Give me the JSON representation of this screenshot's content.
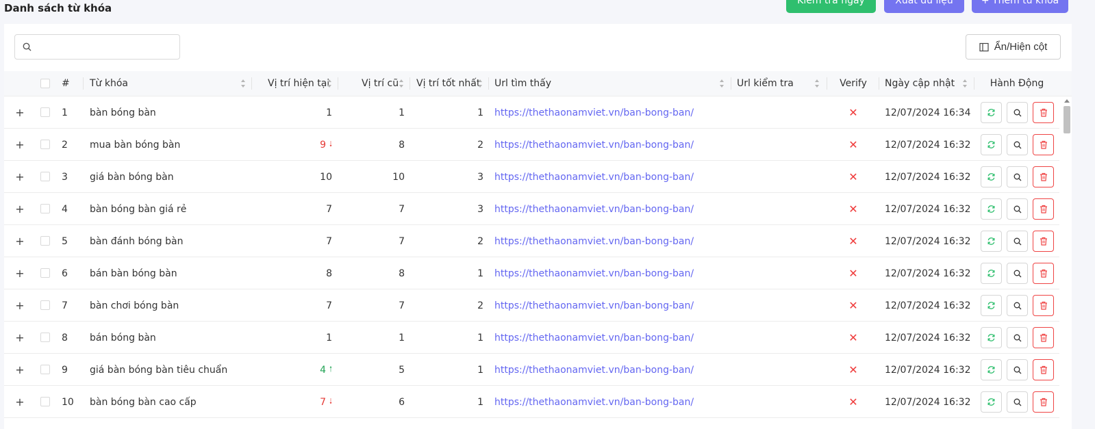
{
  "page": {
    "title": "Danh sách từ khóa",
    "buttons": {
      "check_now": "Kiểm tra ngay",
      "export": "Xuất dữ liệu",
      "add_keyword": "+ Thêm từ khóa"
    }
  },
  "toolbar": {
    "search_placeholder": "",
    "column_toggle": "Ẩn/Hiện cột"
  },
  "table": {
    "headers": {
      "index": "#",
      "keyword": "Từ khóa",
      "current_pos": "Vị trí hiện tại",
      "old_pos": "Vị trí cũ",
      "best_pos": "Vị trí tốt nhất",
      "url_found": "Url tìm thấy",
      "url_check": "Url kiểm tra",
      "verify": "Verify",
      "updated": "Ngày cập nhật",
      "actions": "Hành Động"
    },
    "rows": [
      {
        "index": "1",
        "keyword": "bàn bóng bàn",
        "current": "1",
        "trend": "",
        "old": "1",
        "best": "1",
        "url": "https://thethaonamviet.vn/ban-bong-ban/",
        "url_check": "",
        "verify": "✕",
        "updated": "12/07/2024 16:34"
      },
      {
        "index": "2",
        "keyword": "mua bàn bóng bàn",
        "current": "9",
        "trend": "down",
        "old": "8",
        "best": "2",
        "url": "https://thethaonamviet.vn/ban-bong-ban/",
        "url_check": "",
        "verify": "✕",
        "updated": "12/07/2024 16:32"
      },
      {
        "index": "3",
        "keyword": "giá bàn bóng bàn",
        "current": "10",
        "trend": "",
        "old": "10",
        "best": "3",
        "url": "https://thethaonamviet.vn/ban-bong-ban/",
        "url_check": "",
        "verify": "✕",
        "updated": "12/07/2024 16:32"
      },
      {
        "index": "4",
        "keyword": "bàn bóng bàn giá rẻ",
        "current": "7",
        "trend": "",
        "old": "7",
        "best": "3",
        "url": "https://thethaonamviet.vn/ban-bong-ban/",
        "url_check": "",
        "verify": "✕",
        "updated": "12/07/2024 16:32"
      },
      {
        "index": "5",
        "keyword": "bàn đánh bóng bàn",
        "current": "7",
        "trend": "",
        "old": "7",
        "best": "2",
        "url": "https://thethaonamviet.vn/ban-bong-ban/",
        "url_check": "",
        "verify": "✕",
        "updated": "12/07/2024 16:32"
      },
      {
        "index": "6",
        "keyword": "bán bàn bóng bàn",
        "current": "8",
        "trend": "",
        "old": "8",
        "best": "1",
        "url": "https://thethaonamviet.vn/ban-bong-ban/",
        "url_check": "",
        "verify": "✕",
        "updated": "12/07/2024 16:32"
      },
      {
        "index": "7",
        "keyword": "bàn chơi bóng bàn",
        "current": "7",
        "trend": "",
        "old": "7",
        "best": "2",
        "url": "https://thethaonamviet.vn/ban-bong-ban/",
        "url_check": "",
        "verify": "✕",
        "updated": "12/07/2024 16:32"
      },
      {
        "index": "8",
        "keyword": "bán bóng bàn",
        "current": "1",
        "trend": "",
        "old": "1",
        "best": "1",
        "url": "https://thethaonamviet.vn/ban-bong-ban/",
        "url_check": "",
        "verify": "✕",
        "updated": "12/07/2024 16:32"
      },
      {
        "index": "9",
        "keyword": "giá bàn bóng bàn tiêu chuẩn",
        "current": "4",
        "trend": "up",
        "old": "5",
        "best": "1",
        "url": "https://thethaonamviet.vn/ban-bong-ban/",
        "url_check": "",
        "verify": "✕",
        "updated": "12/07/2024 16:32"
      },
      {
        "index": "10",
        "keyword": "bàn bóng bàn cao cấp",
        "current": "7",
        "trend": "down",
        "old": "6",
        "best": "1",
        "url": "https://thethaonamviet.vn/ban-bong-ban/",
        "url_check": "",
        "verify": "✕",
        "updated": "12/07/2024 16:32"
      }
    ]
  },
  "colors": {
    "primary": "#7474f0",
    "success": "#2fbf6e",
    "danger": "#ef4444",
    "link": "#6366f1"
  },
  "icons": {
    "search": "search-icon",
    "columns": "columns-icon",
    "refresh": "refresh-icon",
    "view": "search-icon",
    "delete": "trash-icon"
  }
}
